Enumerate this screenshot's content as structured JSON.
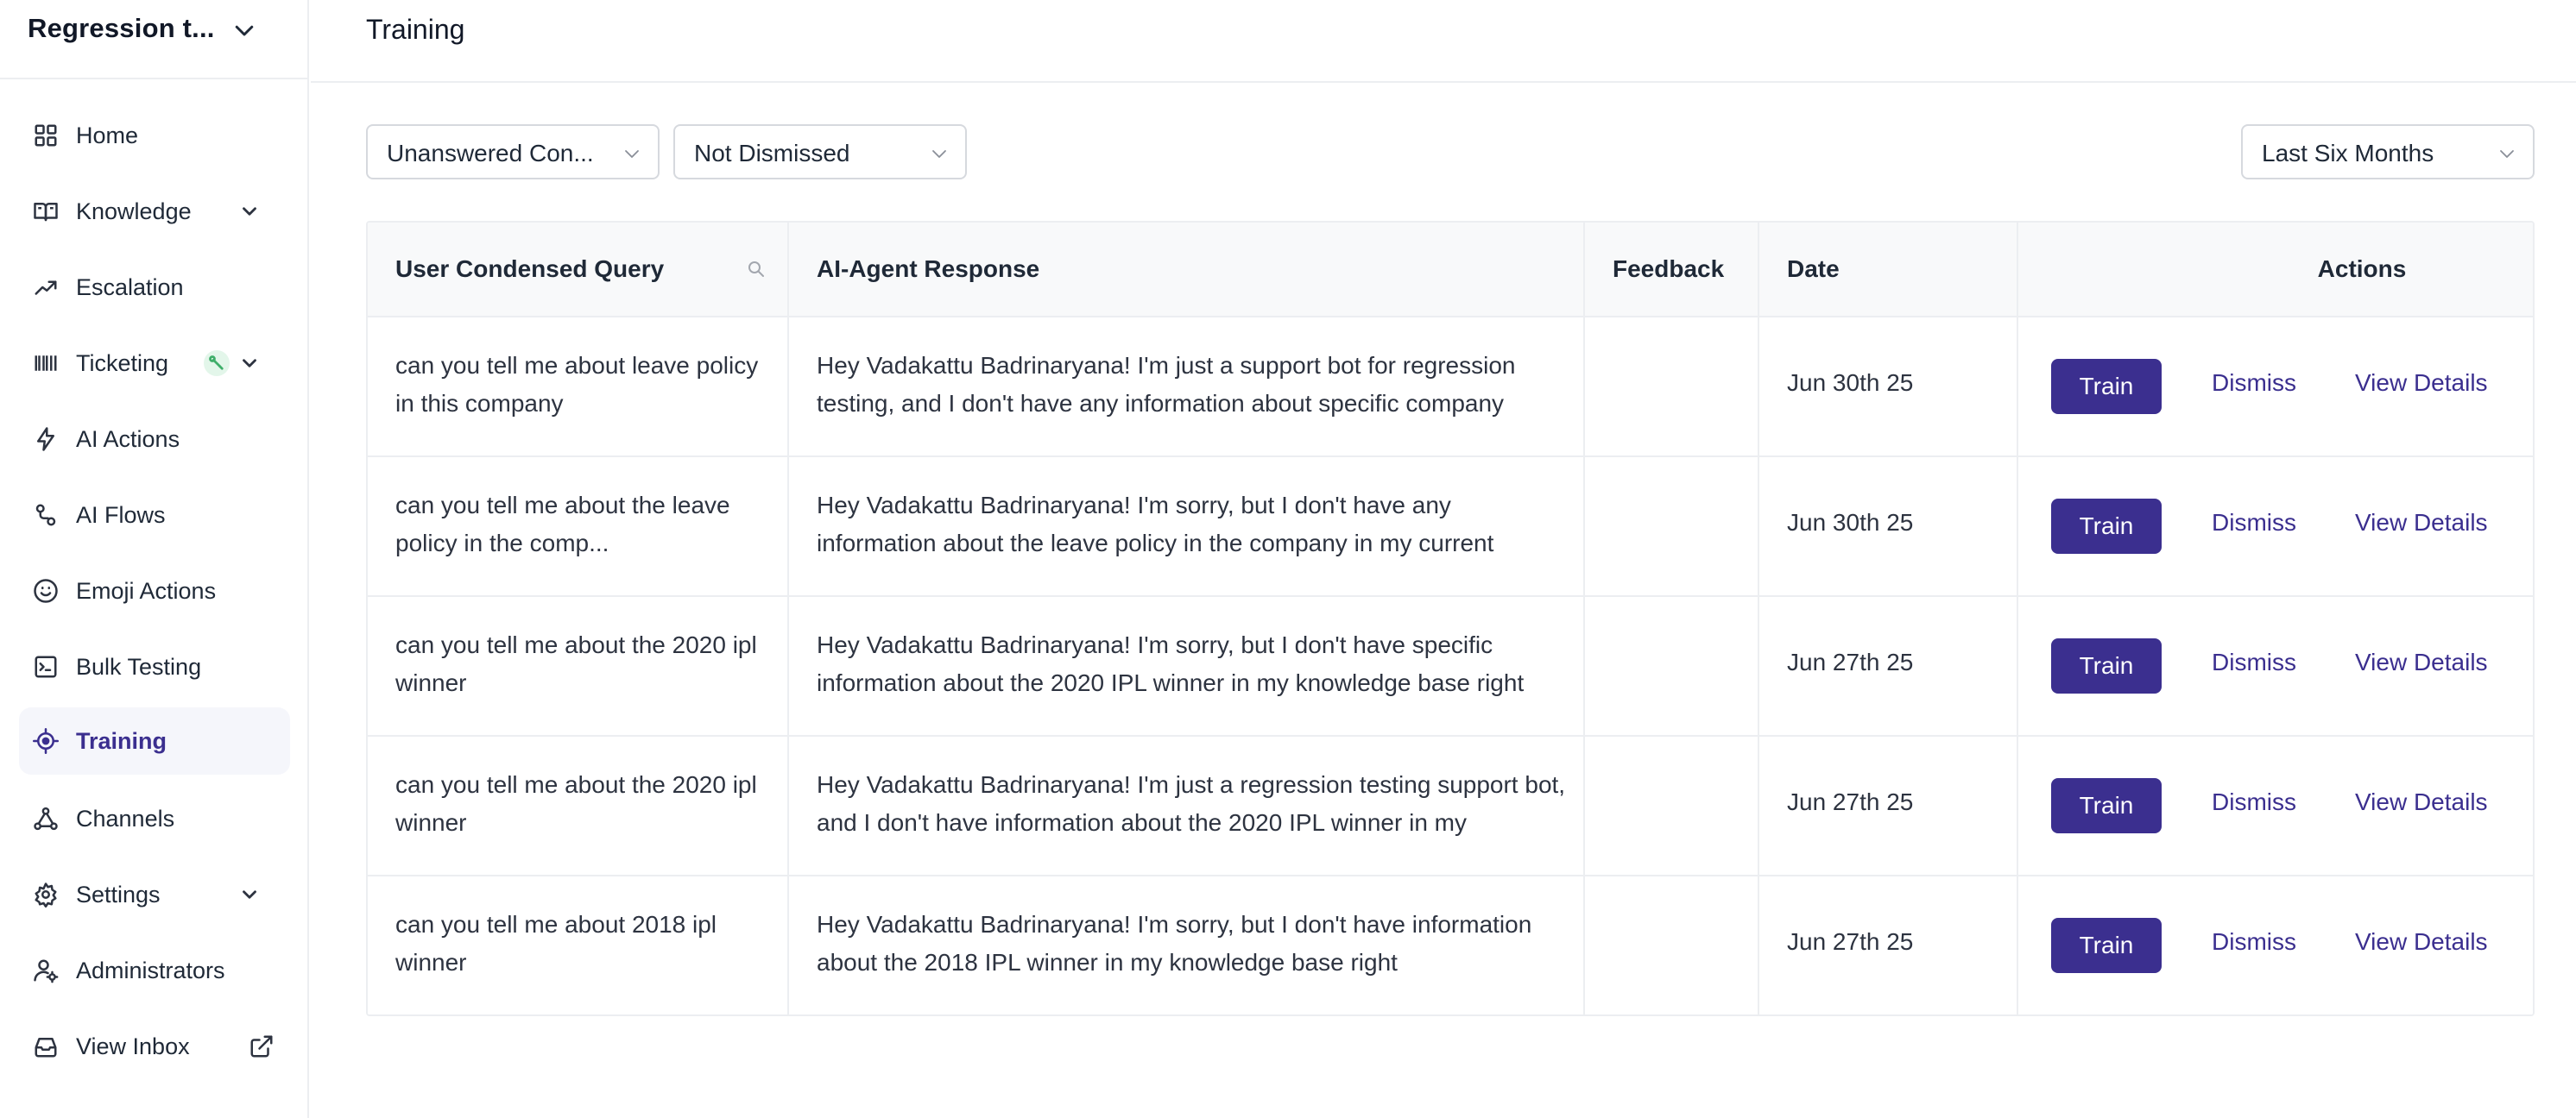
{
  "workspace": {
    "name": "Regression t..."
  },
  "sidebar": {
    "items": [
      {
        "label": "Home",
        "icon": "grid-icon"
      },
      {
        "label": "Knowledge",
        "icon": "book-icon"
      },
      {
        "label": "Escalation",
        "icon": "trend-up-icon"
      },
      {
        "label": "Ticketing",
        "icon": "barcode-icon"
      },
      {
        "label": "AI Actions",
        "icon": "lightning-icon"
      },
      {
        "label": "AI Flows",
        "icon": "flow-icon"
      },
      {
        "label": "Emoji Actions",
        "icon": "smiley-icon"
      },
      {
        "label": "Bulk Testing",
        "icon": "terminal-icon"
      },
      {
        "label": "Training",
        "icon": "crosshair-icon",
        "active": true
      },
      {
        "label": "Channels",
        "icon": "network-icon"
      },
      {
        "label": "Settings",
        "icon": "gear-icon"
      },
      {
        "label": "Administrators",
        "icon": "user-gear-icon"
      },
      {
        "label": "View Inbox",
        "icon": "inbox-icon"
      }
    ]
  },
  "header": {
    "title": "Training"
  },
  "filters": {
    "type": "Unanswered Con...",
    "status": "Not Dismissed",
    "range": "Last Six Months"
  },
  "table": {
    "columns": {
      "query": "User Condensed Query",
      "response": "AI-Agent Response",
      "feedback": "Feedback",
      "date": "Date",
      "actions": "Actions"
    },
    "rows": [
      {
        "query": "can you tell me about leave policy in this company",
        "response": "Hey Vadakattu Badrinaryana! I'm just a support bot for regression testing, and I don't have any information about specific company",
        "feedback": "",
        "date": "Jun 30th 25",
        "train": "Train",
        "dismiss": "Dismiss",
        "view": "View Details"
      },
      {
        "query": "can you tell me about the leave policy in the comp...",
        "response": "Hey Vadakattu Badrinaryana! I'm sorry, but I don't have any information about the leave policy in the company in my current",
        "feedback": "",
        "date": "Jun 30th 25",
        "train": "Train",
        "dismiss": "Dismiss",
        "view": "View Details"
      },
      {
        "query": "can you tell me about the 2020 ipl winner",
        "response": "Hey Vadakattu Badrinaryana! I'm sorry, but I don't have specific information about the 2020 IPL winner in my knowledge base right",
        "feedback": "",
        "date": "Jun 27th 25",
        "train": "Train",
        "dismiss": "Dismiss",
        "view": "View Details"
      },
      {
        "query": "can you tell me about the 2020 ipl winner",
        "response": "Hey Vadakattu Badrinaryana! I'm just a regression testing support bot, and I don't have information about the 2020 IPL winner in my",
        "feedback": "",
        "date": "Jun 27th 25",
        "train": "Train",
        "dismiss": "Dismiss",
        "view": "View Details"
      },
      {
        "query": "can you tell me about 2018 ipl winner",
        "response": "Hey Vadakattu Badrinaryana! I'm sorry, but I don't have information about the 2018 IPL winner in my knowledge base right",
        "feedback": "",
        "date": "Jun 27th 25",
        "train": "Train",
        "dismiss": "Dismiss",
        "view": "View Details"
      }
    ]
  },
  "colors": {
    "accent": "#3b2f8f",
    "active_nav_bg": "#f5f6fb",
    "border": "#eceef1",
    "header_bg": "#f8f9fa"
  }
}
